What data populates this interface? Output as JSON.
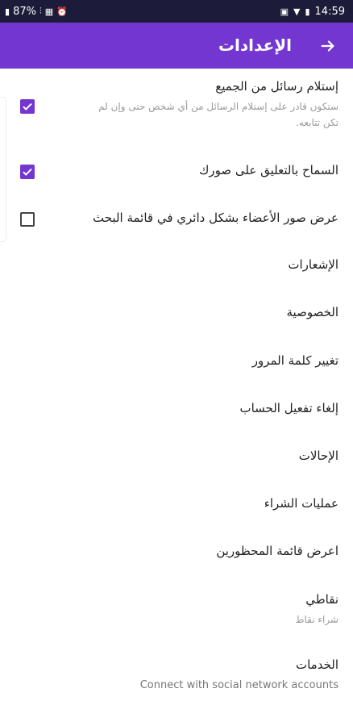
{
  "status_bar": {
    "battery": "87%",
    "time": "14:59"
  },
  "app_bar": {
    "title": "الإعدادات"
  },
  "settings": {
    "receive_messages": {
      "title": "إستلام رسائل من الجميع",
      "subtitle_line1": "ستكون قادر على إستلام الرسائل من أي شخص حتى وإن لم",
      "subtitle_line2": "تكن تتابعه.",
      "checked": true
    },
    "allow_comments": {
      "title": "السماح بالتعليق على صورك",
      "checked": true
    },
    "circle_photos": {
      "title": "عرض صور الأعضاء بشكل دائري في قائمة البحث",
      "checked": false
    },
    "notifications": {
      "title": "الإشعارات"
    },
    "privacy": {
      "title": "الخصوصية"
    },
    "change_password": {
      "title": "تغيير كلمة المرور"
    },
    "deactivate_account": {
      "title": "إلغاء تفعيل الحساب"
    },
    "referrals": {
      "title": "الإحالات"
    },
    "purchases": {
      "title": "عمليات الشراء"
    },
    "blocked_list": {
      "title": "اعرض قائمة المحظورين"
    },
    "points": {
      "title": "نقاطي",
      "subtitle": "شراء نقاط"
    },
    "services": {
      "title": "الخدمات",
      "subtitle": "Connect with social network accounts"
    }
  },
  "colors": {
    "accent": "#7336d1",
    "status_bar": "#1c1c3a"
  }
}
